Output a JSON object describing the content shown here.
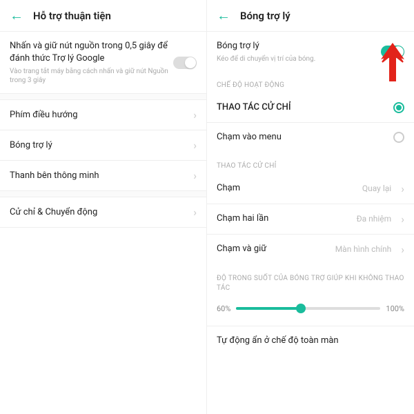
{
  "left": {
    "title": "Hỗ trợ thuận tiện",
    "assistant": {
      "title": "Nhấn và giữ nút nguồn trong 0,5 giây để đánh thức Trợ lý Google",
      "sub": "Vào trang tắt máy bằng cách nhấn và giữ nút Nguồn trong 3 giây"
    },
    "nav_keys": "Phím điều hướng",
    "assistant_ball": "Bóng trợ lý",
    "smart_sidebar": "Thanh bên thông minh",
    "gestures": "Cử chỉ & Chuyển động"
  },
  "right": {
    "title": "Bóng trợ lý",
    "ball": {
      "title": "Bóng trợ lý",
      "sub": "Kéo để di chuyển vị trí của bóng."
    },
    "mode_label": "CHẾ ĐỘ HOẠT ĐỘNG",
    "gesture_opt": "THAO TÁC CỬ CHỈ",
    "menu_opt": "Chạm vào menu",
    "actions_label": "THAO TÁC CỬ CHỈ",
    "tap": {
      "label": "Chạm",
      "value": "Quay lại"
    },
    "double_tap": {
      "label": "Chạm hai lần",
      "value": "Đa nhiệm"
    },
    "hold": {
      "label": "Chạm và giữ",
      "value": "Màn hình chính"
    },
    "opacity_label": "ĐỘ TRONG SUỐT CỦA BÓNG TRỢ GIÚP KHI KHÔNG THAO TÁC",
    "opacity_min": "60%",
    "opacity_max": "100%",
    "auto_hide": "Tự động ẩn ở chế độ toàn màn"
  }
}
